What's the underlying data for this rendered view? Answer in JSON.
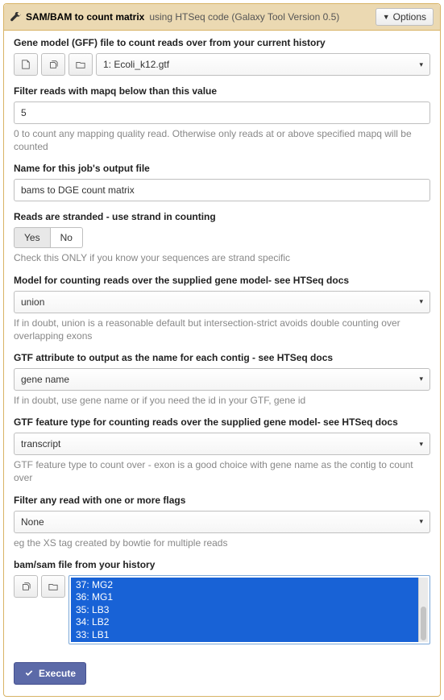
{
  "header": {
    "title": "SAM/BAM to count matrix",
    "subtitle": "using HTSeq code (Galaxy Tool Version 0.5)",
    "options_label": "Options"
  },
  "params": {
    "gff": {
      "label": "Gene model (GFF) file to count reads over from your current history",
      "selected": "1: Ecoli_k12.gtf"
    },
    "mapq": {
      "label": "Filter reads with mapq below than this value",
      "value": "5",
      "help": "0 to count any mapping quality read. Otherwise only reads at or above specified mapq will be counted"
    },
    "jobname": {
      "label": "Name for this job's output file",
      "value": "bams to DGE count matrix"
    },
    "stranded": {
      "label": "Reads are stranded - use strand in counting",
      "yes": "Yes",
      "no": "No",
      "help": "Check this ONLY if you know your sequences are strand specific"
    },
    "model": {
      "label": "Model for counting reads over the supplied gene model- see HTSeq docs",
      "selected": "union",
      "help": "If in doubt, union is a reasonable default but intersection-strict avoids double counting over overlapping exons"
    },
    "gtf_attr": {
      "label": "GTF attribute to output as the name for each contig - see HTSeq docs",
      "selected": "gene name",
      "help": "If in doubt, use gene name or if you need the id in your GTF, gene id"
    },
    "gtf_feat": {
      "label": "GTF feature type for counting reads over the supplied gene model- see HTSeq docs",
      "selected": "transcript",
      "help": "GTF feature type to count over - exon is a good choice with gene name as the contig to count over"
    },
    "flags": {
      "label": "Filter any read with one or more flags",
      "selected": "None",
      "help": "eg the XS tag created by bowtie for multiple reads"
    },
    "bam": {
      "label": "bam/sam file from your history",
      "items": [
        "37: MG2",
        "36: MG1",
        "35: LB3",
        "34: LB2",
        "33: LB1"
      ]
    }
  },
  "execute_label": "Execute"
}
